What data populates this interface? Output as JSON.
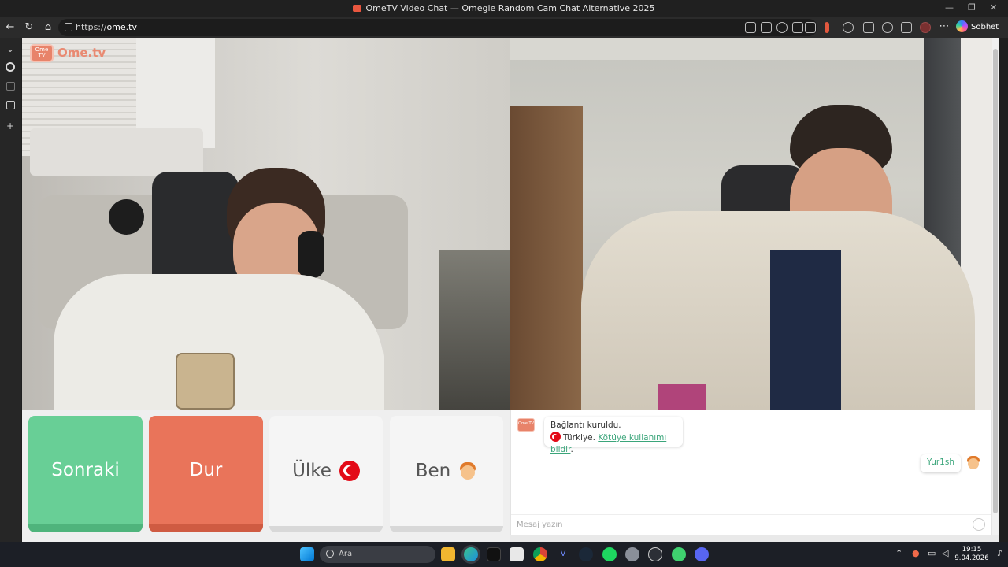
{
  "window": {
    "title": "OmeTV Video Chat — Omegle Random Cam Chat Alternative 2025"
  },
  "browser": {
    "url_prefix": "https://",
    "url_domain": "ome.tv",
    "copilot_label": "Sobhet et"
  },
  "site": {
    "logo_icon_text": "Ome TV",
    "logo_text": "Ome.tv"
  },
  "controls": {
    "next_label": "Sonraki",
    "stop_label": "Dur",
    "country_label": "Ülke",
    "me_label": "Ben"
  },
  "chat": {
    "system_line1": "Bağlantı kuruldu.",
    "system_country": "Türkiye.",
    "report_link": "Kötüye kullanımı bildir",
    "my_name": "Yur1sh",
    "input_placeholder": "Mesaj yazın"
  },
  "taskbar": {
    "search_placeholder": "Ara",
    "time": "19:15",
    "date": "9.04.2026"
  },
  "colors": {
    "next": "#68cf96",
    "stop": "#e9745a",
    "link": "#3aa57a"
  }
}
